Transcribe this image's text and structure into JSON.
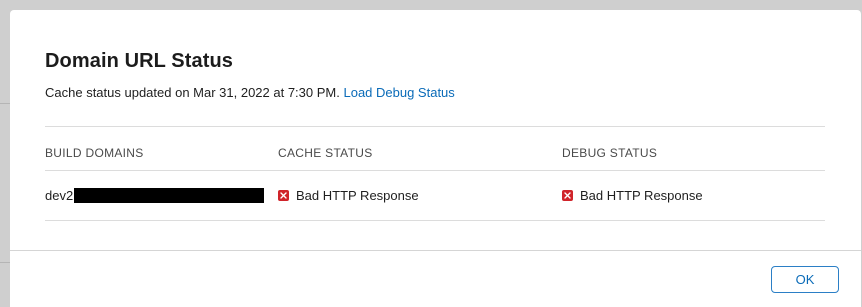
{
  "dialog": {
    "title": "Domain URL Status",
    "cache_updated_text": "Cache status updated on Mar 31, 2022 at 7:30 PM.",
    "load_debug_link": "Load Debug Status"
  },
  "table": {
    "columns": [
      "BUILD DOMAINS",
      "CACHE STATUS",
      "DEBUG STATUS"
    ],
    "rows": [
      {
        "domain_visible": "dev2",
        "domain_redacted": true,
        "cache_status": "Bad HTTP Response",
        "cache_status_icon": "error-x-icon",
        "debug_status": "Bad HTTP Response",
        "debug_status_icon": "error-x-icon"
      }
    ]
  },
  "footer": {
    "ok_label": "OK"
  },
  "colors": {
    "accent": "#0a6bb8",
    "error": "#d0242a"
  }
}
